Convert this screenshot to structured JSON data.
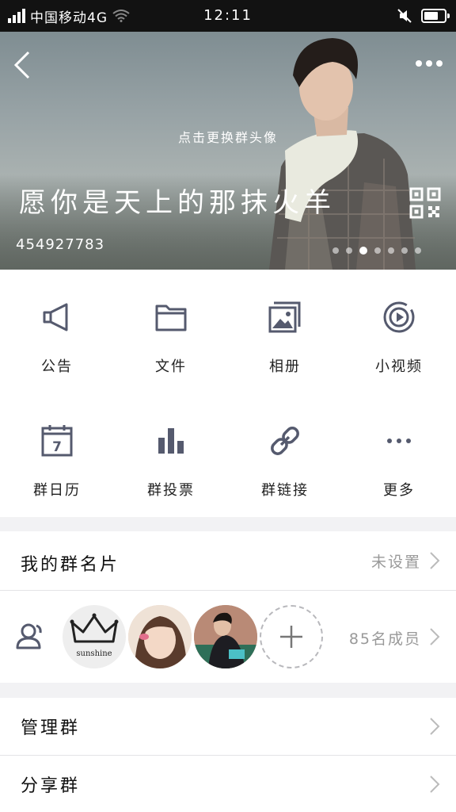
{
  "status_bar": {
    "carrier": "中国移动4G",
    "time": "12:11",
    "battery_level": 0.7
  },
  "header": {
    "hint": "点击更换群头像",
    "group_name": "愿你是天上的那抹火羊",
    "group_id": "454927783",
    "page_count": 7,
    "active_page": 2
  },
  "tools": [
    {
      "label": "公告",
      "icon": "megaphone-icon"
    },
    {
      "label": "文件",
      "icon": "folder-icon"
    },
    {
      "label": "相册",
      "icon": "album-icon"
    },
    {
      "label": "小视频",
      "icon": "video-icon"
    },
    {
      "label": "群日历",
      "icon": "calendar-icon"
    },
    {
      "label": "群投票",
      "icon": "poll-icon"
    },
    {
      "label": "群链接",
      "icon": "link-icon"
    },
    {
      "label": "更多",
      "icon": "more-icon"
    }
  ],
  "calendar_day": "7",
  "my_card": {
    "label": "我的群名片",
    "value": "未设置"
  },
  "members": {
    "count_text": "85名成员",
    "avatar1_text": "sunshine"
  },
  "manage": {
    "label": "管理群"
  },
  "share": {
    "label": "分享群"
  },
  "colors": {
    "icon": "#555a6e",
    "divider": "#e3e3e6",
    "background": "#f2f2f4"
  }
}
